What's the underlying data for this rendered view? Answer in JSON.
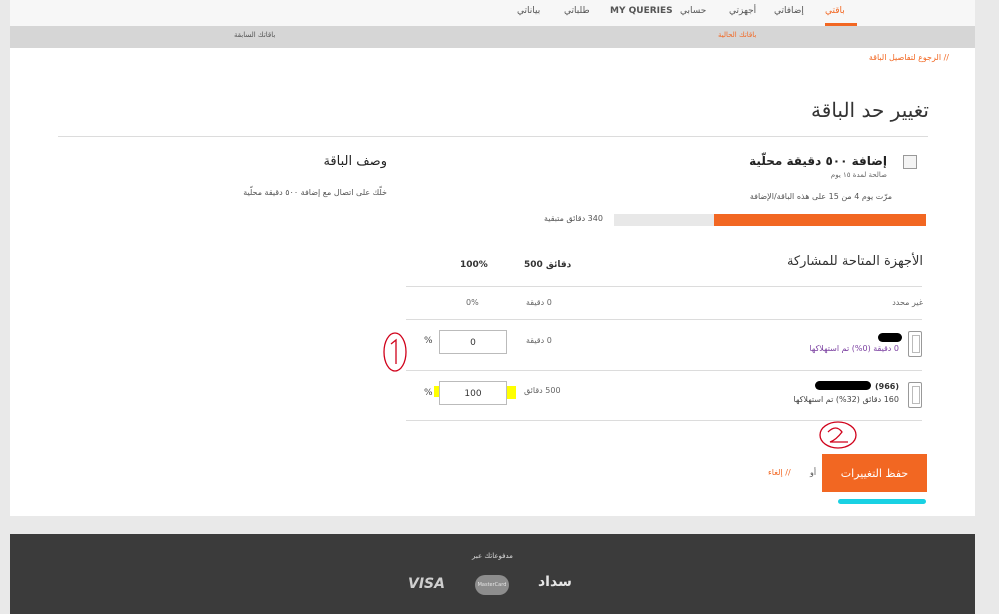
{
  "nav": {
    "items": [
      {
        "label": "باقتي",
        "active": true
      },
      {
        "label": "إضافاتي",
        "active": false
      },
      {
        "label": "أجهزتي",
        "active": false
      },
      {
        "label": "حسابي",
        "active": false
      },
      {
        "label": "MY QUERIES",
        "active": false
      },
      {
        "label": "طلباتي",
        "active": false
      },
      {
        "label": "بياناتي",
        "active": false
      }
    ]
  },
  "subnav": {
    "current": "باقاتك الحالية",
    "previous": "باقاتك السابقة"
  },
  "back_link": "// الرجوع لتفاصيل الباقة",
  "page_title": "تغيير حد الباقة",
  "package": {
    "name": "إضافة ٥٠٠ دقيقة محلّية",
    "validity": "صالحة لمدة ١٥ يوم",
    "elapsed": "مرّت يوم 4 من 15 على هذه الباقة/الإضافة",
    "remaining": "340 دقائق متبقية",
    "remaining_fraction": 0.68
  },
  "description": {
    "title": "وصف الباقة",
    "text": "خلّك على اتصال مع إضافة ٥٠٠ دقيقة محلّية"
  },
  "devices": {
    "title": "الأجهزة المتاحة للمشاركة",
    "total_minutes": "500 دقائق",
    "total_percent": "100%",
    "unassigned": {
      "label": "غير محدد",
      "minutes": "0 دقيقة",
      "percent": "0%"
    },
    "rows": [
      {
        "name": "",
        "usage": "0 دقيقة (0%) تم استهلاكها",
        "minutes": "0 دقيقة",
        "percent_value": "0",
        "percent_sign": "%"
      },
      {
        "name": "(966)",
        "usage": "160 دقائق (32%) تم استهلاكها",
        "minutes": "500 دقائق",
        "percent_value": "100",
        "percent_sign": "%"
      }
    ]
  },
  "actions": {
    "save": "حفظ التغييرات",
    "or": "أو",
    "cancel": "// إلغاء"
  },
  "footer": {
    "pay_title": "مدفوعاتك عبر",
    "visa": "VISA",
    "mastercard": "MasterCard",
    "sadad": "سداد"
  },
  "colors": {
    "accent": "#f26722",
    "footer_bg": "#3b3b3b",
    "highlight_yellow": "#ffff00",
    "underline_cyan": "#19d1e3",
    "annotation_red": "#d0021b"
  }
}
